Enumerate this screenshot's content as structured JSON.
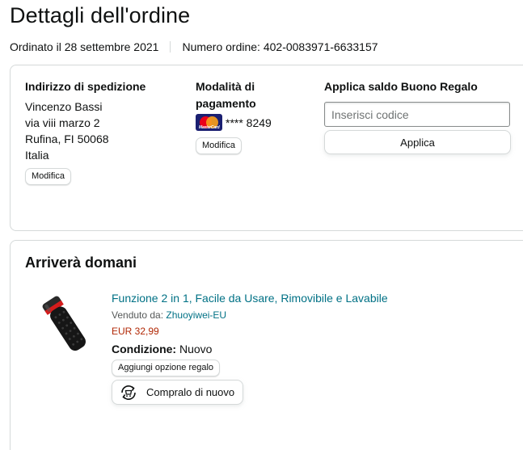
{
  "page": {
    "title": "Dettagli dell'ordine",
    "order_date": "Ordinato il 28 settembre 2021",
    "order_number": "Numero ordine: 402-0083971-6633157"
  },
  "shipping": {
    "heading": "Indirizzo di spedizione",
    "lines": [
      "Vincenzo Bassi",
      "via viii marzo 2",
      "Rufina, FI 50068",
      "Italia"
    ],
    "edit_label": "Modifica"
  },
  "payment": {
    "heading_line1": "Modalità di",
    "heading_line2": "pagamento",
    "card_icon": "mastercard-icon",
    "card_brand_text": "MasterCard",
    "card_masked": "**** 8249",
    "edit_label": "Modifica",
    "colors": {
      "red": "#eb001b",
      "orange": "#f79e1b",
      "navy": "#1a1f71"
    }
  },
  "gift_card": {
    "heading": "Applica saldo Buono Regalo",
    "input_placeholder": "Inserisci codice",
    "input_value": "",
    "apply_label": "Applica"
  },
  "delivery": {
    "heading": "Arriverà domani",
    "item": {
      "image_icon": "flashlight-product-image",
      "title": "Funzione 2 in 1, Facile da Usare, Rimovibile e Lavabile",
      "seller_label": "Venduto da: ",
      "seller_name": "Zhuoyiwei-EU",
      "price": "EUR 32,99",
      "condition_label": "Condizione:",
      "condition_value": " Nuovo",
      "gift_option_label": "Aggiungi opzione regalo",
      "buy_again_label": "Compralo di nuovo",
      "buy_again_icon": "buy-again-icon"
    }
  },
  "colors": {
    "link": "#007185",
    "price": "#b12704",
    "text": "#0f1111",
    "border": "#d5d9d9"
  }
}
